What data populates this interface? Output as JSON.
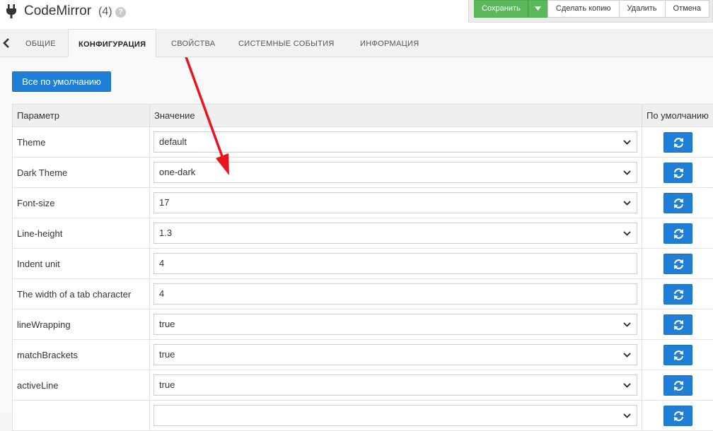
{
  "header": {
    "title": "CodeMirror",
    "count": "(4)",
    "help_icon": "?",
    "icon": "plug-icon"
  },
  "actions": {
    "save": "Сохранить",
    "caret": "▾",
    "copy": "Сделать копию",
    "delete": "Удалить",
    "cancel": "Отмена"
  },
  "tabs": [
    "ОБЩИЕ",
    "КОНФИГУРАЦИЯ",
    "СВОЙСТВА",
    "СИСТЕМНЫЕ СОБЫТИЯ",
    "ИНФОРМАЦИЯ"
  ],
  "active_tab": "КОНФИГУРАЦИЯ",
  "defaults_button": "Все по умолчанию",
  "table": {
    "headers": [
      "Параметр",
      "Значение",
      "По умолчанию"
    ],
    "rows": [
      {
        "param": "Theme",
        "value": "default",
        "control": "select"
      },
      {
        "param": "Dark Theme",
        "value": "one-dark",
        "control": "select"
      },
      {
        "param": "Font-size",
        "value": "17",
        "control": "select"
      },
      {
        "param": "Line-height",
        "value": "1.3",
        "control": "select"
      },
      {
        "param": "Indent unit",
        "value": "4",
        "control": "input"
      },
      {
        "param": "The width of a tab character",
        "value": "4",
        "control": "input"
      },
      {
        "param": "lineWrapping",
        "value": "true",
        "control": "select"
      },
      {
        "param": "matchBrackets",
        "value": "true",
        "control": "select"
      },
      {
        "param": "activeLine",
        "value": "true",
        "control": "select"
      },
      {
        "param": "",
        "value": "",
        "control": "select"
      }
    ]
  },
  "colors": {
    "primary": "#1f7fd6",
    "success": "#5cb85c",
    "annotation_arrow": "#e8141e"
  }
}
